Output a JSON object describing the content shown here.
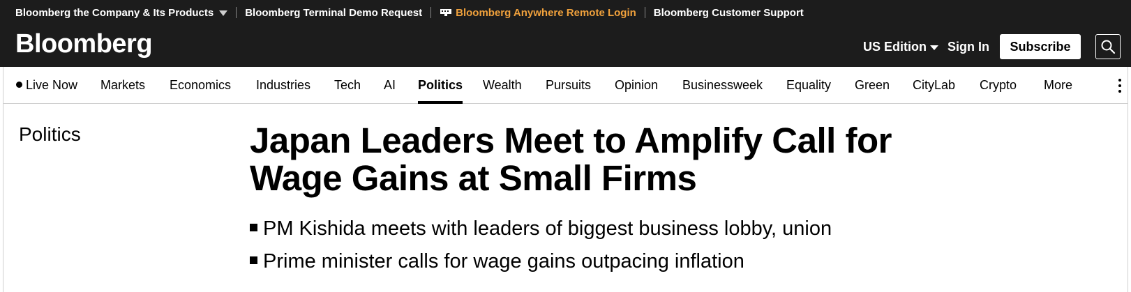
{
  "utility_bar": {
    "company_link": "Bloomberg the Company & Its Products",
    "terminal_demo": "Bloomberg Terminal Demo Request",
    "anywhere_login": "Bloomberg Anywhere Remote Login",
    "customer_support": "Bloomberg Customer Support",
    "accent_color": "#f0a13c"
  },
  "header": {
    "logo": "Bloomberg",
    "edition": "US Edition",
    "sign_in": "Sign In",
    "subscribe": "Subscribe",
    "search_icon": "search-icon"
  },
  "nav": {
    "items": [
      {
        "label": "Live Now"
      },
      {
        "label": "Markets"
      },
      {
        "label": "Economics"
      },
      {
        "label": "Industries"
      },
      {
        "label": "Tech"
      },
      {
        "label": "AI"
      },
      {
        "label": "Politics",
        "active": true
      },
      {
        "label": "Wealth"
      },
      {
        "label": "Pursuits"
      },
      {
        "label": "Opinion"
      },
      {
        "label": "Businessweek"
      },
      {
        "label": "Equality"
      },
      {
        "label": "Green"
      },
      {
        "label": "CityLab"
      },
      {
        "label": "Crypto"
      },
      {
        "label": "More"
      }
    ]
  },
  "article": {
    "section": "Politics",
    "headline": "Japan Leaders Meet to Amplify Call for Wage Gains at Small Firms",
    "bullets": [
      "PM Kishida meets with leaders of biggest business lobby, union",
      "Prime minister calls for wage gains outpacing inflation"
    ]
  }
}
